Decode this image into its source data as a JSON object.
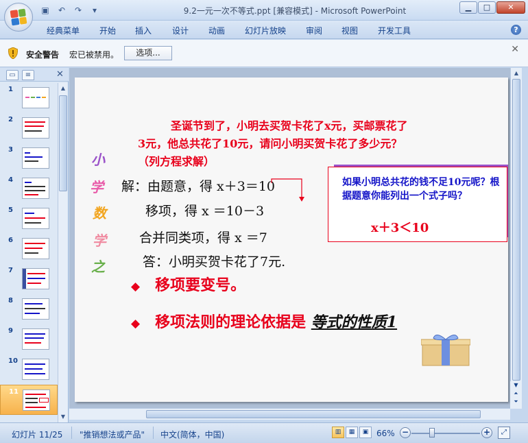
{
  "window": {
    "title": "9.2一元一次不等式.ppt [兼容模式] - Microsoft PowerPoint",
    "minimize_label": "▁",
    "maximize_label": "□",
    "close_label": "✕"
  },
  "ribbon": {
    "tabs": [
      "经典菜单",
      "开始",
      "插入",
      "设计",
      "动画",
      "幻灯片放映",
      "审阅",
      "视图",
      "开发工具"
    ],
    "help_label": "?"
  },
  "security": {
    "title": "安全警告",
    "message": "宏已被禁用。",
    "options_label": "选项...",
    "close_label": "✕"
  },
  "thumbnails": {
    "numbers": [
      "1",
      "2",
      "3",
      "4",
      "5",
      "6",
      "7",
      "8",
      "9",
      "10",
      "11"
    ],
    "selected": "11"
  },
  "slide": {
    "question_line1": "圣诞节到了，小明去买贺卡花了x元，买邮票花了",
    "question_line2": "3元，他总共花了10元，请问小明买贺卡花了多少元？",
    "question_line3": "（列方程求解）",
    "deco": [
      "小",
      "学",
      "数",
      "学",
      "之"
    ],
    "solve_line1": "解：由题意，得  x＋3＝10",
    "solve_line2": "移项，得  x ＝10－3",
    "solve_line3": "合并同类项，得  x ＝7",
    "solve_line4": "答：小明买贺卡花了7元.",
    "callout_text": "如果小明总共花的钱不足10元呢？根据题意你能列出一个式子吗？",
    "callout_formula": "x＋3＜10",
    "bullet1": "移项要变号。",
    "bullet2_prefix": "移项法则的理论依据是",
    "bullet2_answer": "等式的性质1",
    "bullet_symbol": "◆"
  },
  "status": {
    "slide_info": "幻灯片 11/25",
    "theme": "\"推销想法或产品\"",
    "language": "中文(简体，中国)",
    "zoom": "66%",
    "zoom_out": "−",
    "zoom_in": "+"
  },
  "colors": {
    "accent_red": "#e8001b",
    "callout_blue": "#1414c8",
    "callout_purple": "#9a52c9",
    "ribbon_text": "#15428b"
  }
}
